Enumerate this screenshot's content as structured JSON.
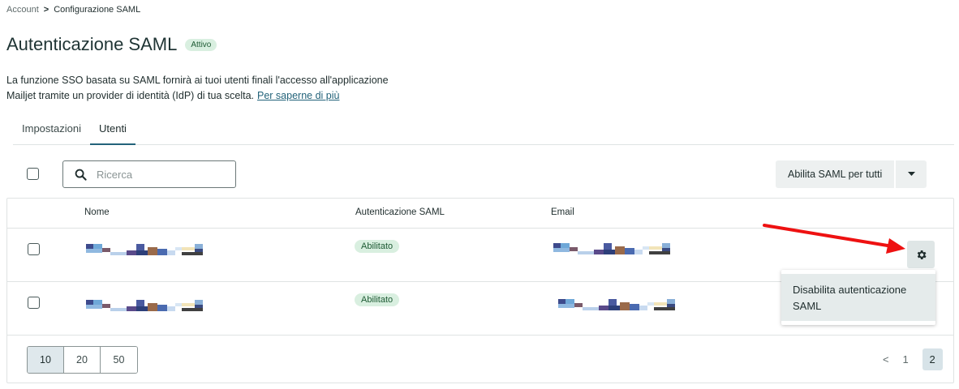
{
  "breadcrumb": {
    "parent": "Account",
    "separator": ">",
    "current": "Configurazione SAML"
  },
  "header": {
    "title": "Autenticazione SAML",
    "status_badge": "Attivo"
  },
  "description": {
    "line1": "La funzione SSO basata su SAML fornirà ai tuoi utenti finali l'accesso all'applicazione",
    "line2": "Mailjet tramite un provider di identità (IdP) di tua scelta.",
    "link": "Per saperne di più"
  },
  "tabs": [
    {
      "label": "Impostazioni",
      "active": false
    },
    {
      "label": "Utenti",
      "active": true
    }
  ],
  "toolbar": {
    "search_placeholder": "Ricerca",
    "search_icon": "search-icon",
    "bulk_action_label": "Abilita SAML per tutti",
    "bulk_action_caret": "caret-down-icon"
  },
  "table": {
    "columns": {
      "name": "Nome",
      "saml": "Autenticazione SAML",
      "email": "Email"
    },
    "rows": [
      {
        "saml_status": "Abilitato"
      },
      {
        "saml_status": "Abilitato"
      }
    ]
  },
  "row_menu": {
    "trigger_icon": "gear-icon",
    "items": [
      "Disabilita autenticazione SAML"
    ]
  },
  "pagination": {
    "page_sizes": [
      "10",
      "20",
      "50"
    ],
    "selected_page_size": "10",
    "prev": "<",
    "pages": [
      "1",
      "2"
    ],
    "current_page": "2"
  },
  "colors": {
    "accent": "#23637a",
    "badge_bg": "#d9efe0",
    "badge_text": "#1d5a33",
    "annotation_arrow": "#ee1111"
  }
}
